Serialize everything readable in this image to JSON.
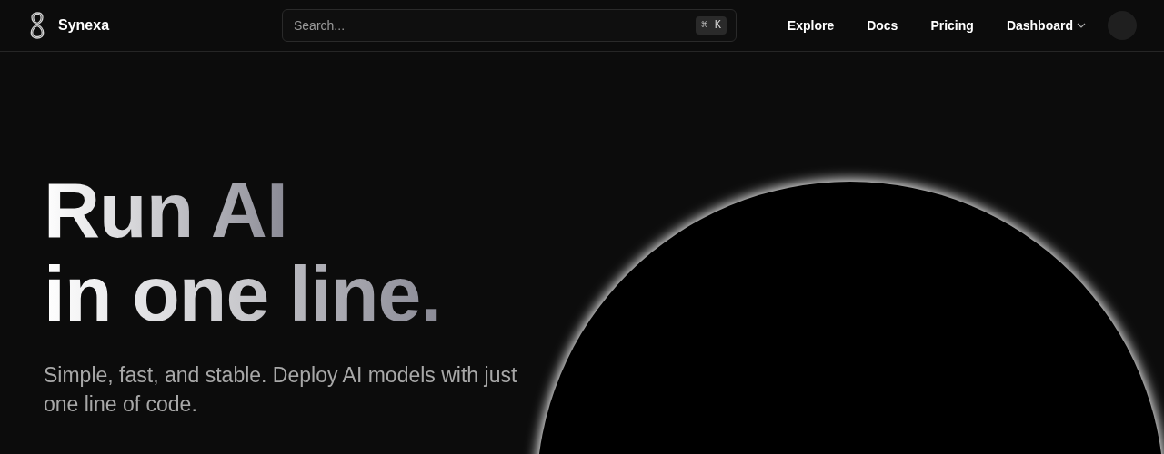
{
  "brand": {
    "name": "Synexa"
  },
  "search": {
    "placeholder": "Search...",
    "shortcut": "⌘ K"
  },
  "nav": [
    {
      "label": "Explore",
      "kind": "link"
    },
    {
      "label": "Docs",
      "kind": "link"
    },
    {
      "label": "Pricing",
      "kind": "link"
    },
    {
      "label": "Dashboard",
      "kind": "dropdown"
    }
  ],
  "hero": {
    "title_lines": [
      "Run AI",
      "in one line."
    ],
    "subtitle": "Simple, fast, and stable. Deploy AI models with just one line of code."
  }
}
